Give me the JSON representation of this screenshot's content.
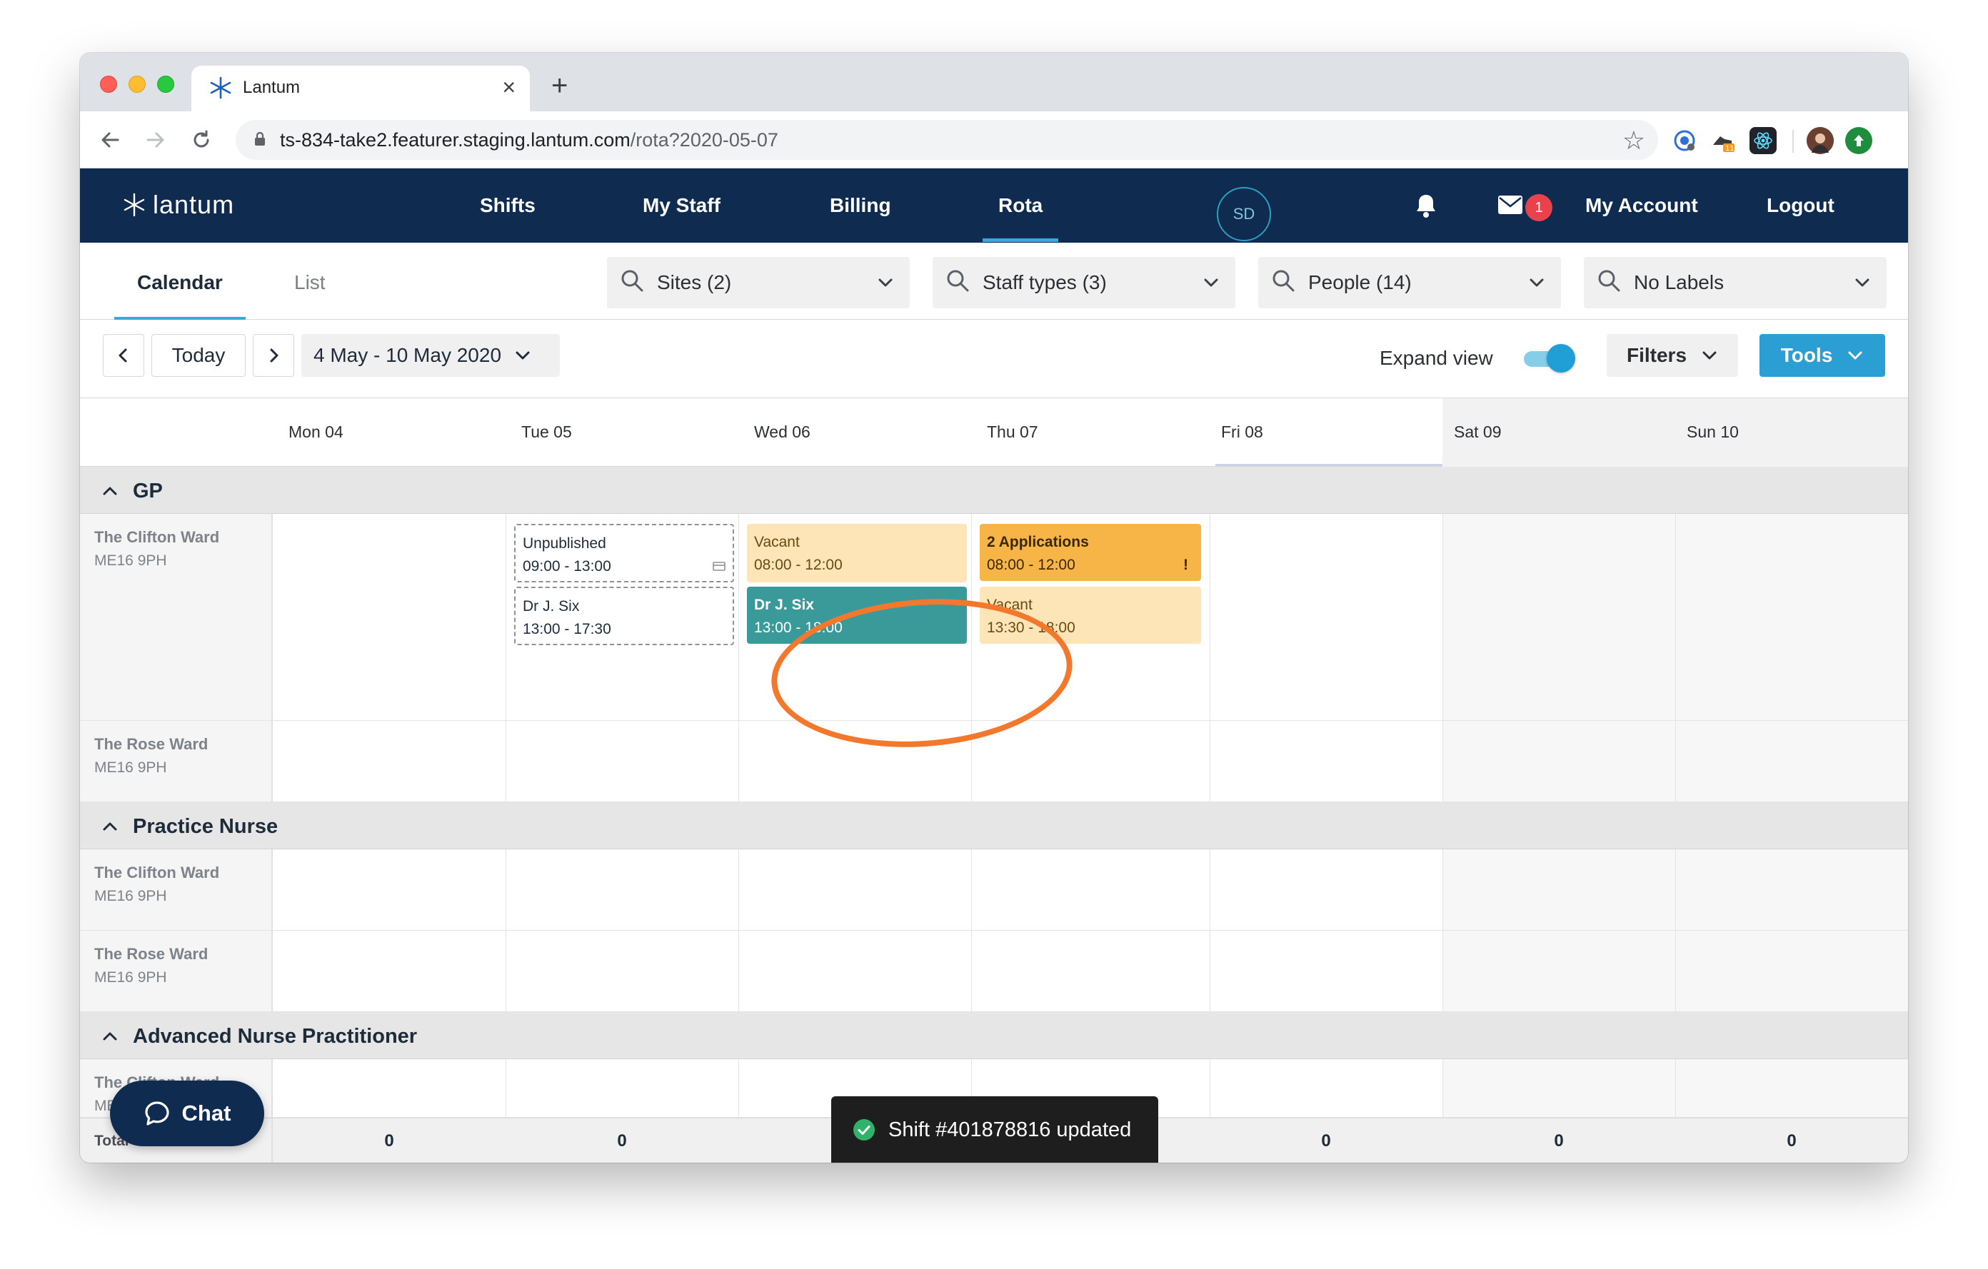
{
  "browser": {
    "tab_title": "Lantum",
    "url_host": "ts-834-take2.featurer.staging.lantum.com",
    "url_path": "/rota?2020-05-07",
    "new_tab": "+",
    "close_tab": "×",
    "ext_badge": "11"
  },
  "nav": {
    "brand": "lantum",
    "links": [
      "Shifts",
      "My Staff",
      "Billing",
      "Rota"
    ],
    "active": "Rota",
    "avatar_initials": "SD",
    "message_count": "1",
    "account": "My Account",
    "logout": "Logout"
  },
  "views": {
    "calendar": "Calendar",
    "list": "List"
  },
  "filters": [
    {
      "label": "Sites (2)"
    },
    {
      "label": "Staff types (3)"
    },
    {
      "label": "People (14)"
    },
    {
      "label": "No Labels"
    }
  ],
  "datebar": {
    "today": "Today",
    "range": "4 May - 10 May 2020",
    "expand_view": "Expand view",
    "expand_view_on": true,
    "filters": "Filters",
    "tools": "Tools"
  },
  "days": [
    "Mon 04",
    "Tue 05",
    "Wed 06",
    "Thu 07",
    "Fri 08",
    "Sat 09",
    "Sun 10"
  ],
  "groups": [
    {
      "title": "GP",
      "sites": [
        {
          "name": "The Clifton Ward",
          "code": "ME16 9PH"
        },
        {
          "name": "The Rose Ward",
          "code": "ME16 9PH"
        }
      ]
    },
    {
      "title": "Practice Nurse",
      "sites": [
        {
          "name": "The Clifton Ward",
          "code": "ME16 9PH"
        },
        {
          "name": "The Rose Ward",
          "code": "ME16 9PH"
        }
      ]
    },
    {
      "title": "Advanced Nurse Practitioner",
      "sites": [
        {
          "name": "The Clifton Ward",
          "code": "ME16 9PH"
        }
      ]
    }
  ],
  "shifts": {
    "tue_unpublished": {
      "title": "Unpublished",
      "time": "09:00 - 13:00"
    },
    "tue_six": {
      "title": "Dr J. Six",
      "time": "13:00 - 17:30"
    },
    "wed_vacant": {
      "title": "Vacant",
      "time": "08:00 - 12:00"
    },
    "wed_six": {
      "title": "Dr J. Six",
      "time": "13:00 - 18:00"
    },
    "thu_apps": {
      "title": "2 Applications",
      "time": "08:00 - 12:00",
      "alert": "!"
    },
    "thu_vacant": {
      "title": "Vacant",
      "time": "13:30 - 18:00"
    }
  },
  "totals": {
    "label": "Total",
    "values": [
      "0",
      "0",
      "",
      "",
      "0",
      "0",
      "0"
    ]
  },
  "chat": "Chat",
  "toast": "Shift #401878816 updated",
  "colors": {
    "navy": "#0f2b4f",
    "accent": "#2b9fd3",
    "vacant": "#fde5b8",
    "applications": "#f7b548",
    "filled": "#3a9a9a",
    "highlight": "#f3782b"
  }
}
